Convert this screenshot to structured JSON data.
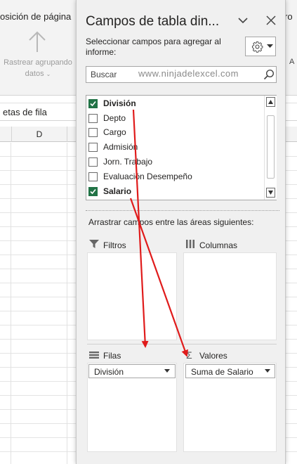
{
  "ribbon": {
    "tab_left": "osición de página",
    "tab_right": "ro",
    "letter_right": "A",
    "button_line1": "Rastrear agrupando",
    "button_line2": "datos"
  },
  "fieldbar": {
    "text": "etas de fila"
  },
  "sheet": {
    "column_d": "D"
  },
  "pane": {
    "title": "Campos de tabla din...",
    "instruction": "Seleccionar campos para agregar al informe:",
    "search_placeholder": "Buscar",
    "watermark": "www.ninjadelexcel.com",
    "fields": [
      {
        "label": "División",
        "checked": true
      },
      {
        "label": "Depto",
        "checked": false
      },
      {
        "label": "Cargo",
        "checked": false
      },
      {
        "label": "Admisión",
        "checked": false
      },
      {
        "label": "Jorn. Trabajo",
        "checked": false
      },
      {
        "label": "Evaluación  Desempeño",
        "checked": false
      },
      {
        "label": "Salario",
        "checked": true
      }
    ],
    "areas_instruction": "Arrastrar campos entre las áreas siguientes:",
    "areas": {
      "filters": "Filtros",
      "columns": "Columnas",
      "rows": "Filas",
      "values": "Valores"
    },
    "rows_chip": "División",
    "values_chip": "Suma de Salario"
  },
  "colors": {
    "excel_green": "#217346",
    "annotation_arrow": "#e01b1b"
  },
  "icons": [
    "arrow-up-icon",
    "chevron-down-icon",
    "close-icon",
    "gear-icon",
    "search-icon",
    "checkmark-icon",
    "filter-icon",
    "columns-icon",
    "rows-icon",
    "sigma-icon"
  ]
}
